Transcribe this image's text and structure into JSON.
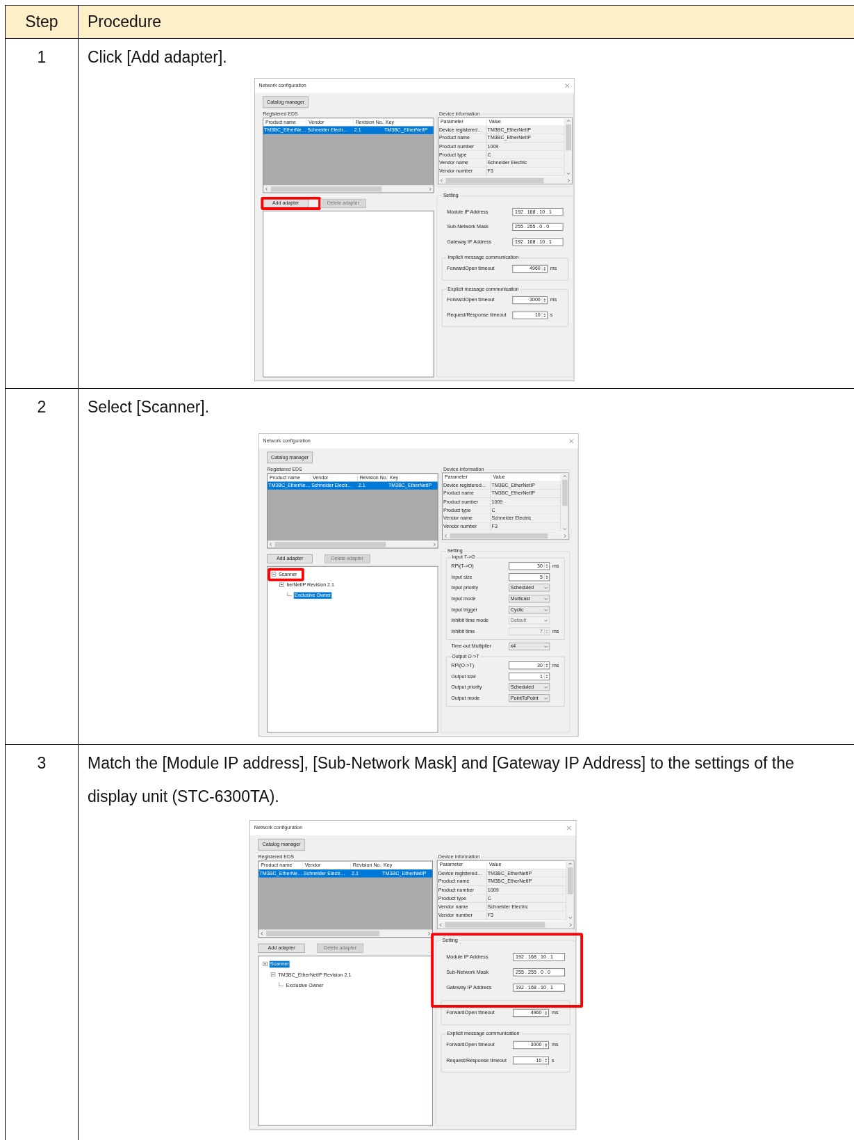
{
  "table": {
    "columns": [
      "Step",
      "Procedure"
    ],
    "rows": [
      {
        "step": "1",
        "instruction": "Click [Add adapter].",
        "dialog": {
          "title": "Network configuration",
          "catalog_button": "Catalog manager",
          "eds": {
            "label": "Registered EDS",
            "columns": [
              "Product name",
              "Vendor",
              "Revision No.",
              "Key"
            ],
            "rows": [
              {
                "cells": [
                  "TM3BC_EtherNe…",
                  "Schneider Electr…",
                  "2.1",
                  "TM3BC_EtherNetIP"
                ],
                "selected": true
              }
            ]
          },
          "device_info": {
            "label": "Device information",
            "columns": [
              "Parameter",
              "Value"
            ],
            "rows": [
              [
                "Device registered…",
                "TM3BC_EtherNetIP"
              ],
              [
                "Product name",
                "TM3BC_EtherNetIP"
              ],
              [
                "Product number",
                "1009"
              ],
              [
                "Product type",
                "C"
              ],
              [
                "Vendor name",
                "Schneider Electric"
              ],
              [
                "Vendor number",
                "F3"
              ]
            ]
          },
          "buttons": [
            {
              "label": "Add adapter",
              "disabled": false,
              "highlighted": true
            },
            {
              "label": "Delete adapter",
              "disabled": true,
              "highlighted": false
            }
          ],
          "settings": {
            "label": "Setting",
            "kind": "network",
            "highlighted": false,
            "groups": [
              {
                "framed": false,
                "rows": [
                  {
                    "kind": "ip",
                    "label": "Module IP Address",
                    "value": "192 . 168 . 10 . 1",
                    "disabled": false
                  },
                  {
                    "kind": "ip",
                    "label": "Sub-Network Mask",
                    "value": "255 . 255 . 0 . 0",
                    "disabled": false
                  },
                  {
                    "kind": "ip",
                    "label": "Gateway IP Address",
                    "value": "192 . 168 . 10 . 1",
                    "disabled": false
                  }
                ]
              },
              {
                "framed": true,
                "label": "Implicit message communication",
                "rows": [
                  {
                    "kind": "spin",
                    "label": "ForwardOpen timeout",
                    "value": "4960",
                    "unit": "ms",
                    "disabled": false
                  }
                ]
              },
              {
                "framed": true,
                "label": "Explicit message communication",
                "rows": [
                  {
                    "kind": "spin",
                    "label": "ForwardOpen timeout",
                    "value": "3000",
                    "unit": "ms",
                    "disabled": false
                  },
                  {
                    "kind": "spin",
                    "label": "Request/Response timeout",
                    "value": "10",
                    "unit": "s",
                    "disabled": false
                  }
                ]
              }
            ]
          }
        }
      },
      {
        "step": "2",
        "instruction": "Select [Scanner].",
        "dialog": {
          "title": "Network configuration",
          "catalog_button": "Catalog manager",
          "eds": {
            "label": "Registered EDS",
            "columns": [
              "Product name",
              "Vendor",
              "Revision No.",
              "Key"
            ],
            "rows": [
              {
                "cells": [
                  "TM3BC_EtherNe…",
                  "Schneider Electr…",
                  "2.1",
                  "TM3BC_EtherNetIP"
                ],
                "selected": true
              }
            ]
          },
          "device_info": {
            "label": "Device information",
            "columns": [
              "Parameter",
              "Value"
            ],
            "rows": [
              [
                "Device registered…",
                "TM3BC_EtherNetIP"
              ],
              [
                "Product name",
                "TM3BC_EtherNetIP"
              ],
              [
                "Product number",
                "1009"
              ],
              [
                "Product type",
                "C"
              ],
              [
                "Vendor name",
                "Schneider Electric"
              ],
              [
                "Vendor number",
                "F3"
              ]
            ]
          },
          "buttons": [
            {
              "label": "Add adapter",
              "disabled": false,
              "highlighted": false
            },
            {
              "label": "Delete adapter",
              "disabled": true,
              "highlighted": false
            }
          ],
          "tree": [
            {
              "label": "Scanner",
              "selected": false,
              "expanded": true,
              "highlighted": true,
              "children": [
                {
                  "label": "herNetIP Revision 2.1",
                  "selected": false,
                  "expanded": true,
                  "highlighted": false,
                  "children": [
                    {
                      "label": "Exclusive Owner",
                      "selected": true,
                      "highlighted": false
                    }
                  ]
                }
              ]
            }
          ],
          "settings": {
            "label": "Setting",
            "kind": "connection",
            "highlighted": false,
            "groups": [
              {
                "framed": true,
                "label": "Input T->O",
                "rows": [
                  {
                    "kind": "spin",
                    "label": "RPI(T->O)",
                    "value": "30",
                    "unit": "ms",
                    "disabled": false
                  },
                  {
                    "kind": "spin",
                    "label": "Input size",
                    "value": "5",
                    "disabled": false
                  },
                  {
                    "kind": "select",
                    "label": "Input priority",
                    "value": "Scheduled",
                    "disabled": false
                  },
                  {
                    "kind": "select",
                    "label": "Input mode",
                    "value": "Multicast",
                    "disabled": false
                  },
                  {
                    "kind": "select",
                    "label": "Input trigger",
                    "value": "Cyclic",
                    "disabled": false
                  },
                  {
                    "kind": "select",
                    "label": "Inhibit time mode",
                    "value": "Default",
                    "disabled": true
                  },
                  {
                    "kind": "spin",
                    "label": "Inhibit time",
                    "value": "7",
                    "unit": "ms",
                    "disabled": true
                  }
                ]
              },
              {
                "framed": false,
                "rows": [
                  {
                    "kind": "select",
                    "label": "Time-out Multiplier",
                    "value": "x4",
                    "disabled": false
                  }
                ]
              },
              {
                "framed": true,
                "label": "Output O->T",
                "rows": [
                  {
                    "kind": "spin",
                    "label": "RPI(O->T)",
                    "value": "30",
                    "unit": "ms",
                    "disabled": false
                  },
                  {
                    "kind": "spin",
                    "label": "Output size",
                    "value": "1",
                    "disabled": false
                  },
                  {
                    "kind": "select",
                    "label": "Output priority",
                    "value": "Scheduled",
                    "disabled": false
                  },
                  {
                    "kind": "select",
                    "label": "Output mode",
                    "value": "PointToPoint",
                    "disabled": false
                  }
                ]
              }
            ]
          }
        }
      },
      {
        "step": "3",
        "instruction": "Match the [Module IP address], [Sub-Network Mask] and [Gateway IP Address] to the settings of the display unit (STC-6300TA).",
        "dialog": {
          "title": "Network configuration",
          "catalog_button": "Catalog manager",
          "eds": {
            "label": "Registered EDS",
            "columns": [
              "Product name",
              "Vendor",
              "Revision No.",
              "Key"
            ],
            "rows": [
              {
                "cells": [
                  "TM3BC_EtherNe…",
                  "Schneider Electr…",
                  "2.1",
                  "TM3BC_EtherNetIP"
                ],
                "selected": true
              }
            ]
          },
          "device_info": {
            "label": "Device information",
            "columns": [
              "Parameter",
              "Value"
            ],
            "rows": [
              [
                "Device registered…",
                "TM3BC_EtherNetIP"
              ],
              [
                "Product name",
                "TM3BC_EtherNetIP"
              ],
              [
                "Product number",
                "1009"
              ],
              [
                "Product type",
                "C"
              ],
              [
                "Vendor name",
                "Schneider Electric"
              ],
              [
                "Vendor number",
                "F3"
              ]
            ]
          },
          "buttons": [
            {
              "label": "Add adapter",
              "disabled": false,
              "highlighted": false
            },
            {
              "label": "Delete adapter",
              "disabled": true,
              "highlighted": false
            }
          ],
          "tree": [
            {
              "label": "Scanner",
              "selected": true,
              "expanded": true,
              "highlighted": false,
              "children": [
                {
                  "label": "TM3BC_EtherNetIP Revision 2.1",
                  "selected": false,
                  "expanded": true,
                  "highlighted": false,
                  "children": [
                    {
                      "label": "Exclusive Owner",
                      "selected": false,
                      "highlighted": false
                    }
                  ]
                }
              ]
            }
          ],
          "settings": {
            "label": "Setting",
            "kind": "network",
            "highlighted": true,
            "groups": [
              {
                "framed": false,
                "rows": [
                  {
                    "kind": "ip",
                    "label": "Module IP Address",
                    "value": "192 . 168 . 10 . 1",
                    "disabled": false
                  },
                  {
                    "kind": "ip",
                    "label": "Sub-Network Mask",
                    "value": "255 . 255 . 0 . 0",
                    "disabled": false
                  },
                  {
                    "kind": "ip",
                    "label": "Gateway IP Address",
                    "value": "192 . 168 . 10 . 1",
                    "disabled": false
                  }
                ]
              },
              {
                "framed": true,
                "rows": [
                  {
                    "kind": "spin",
                    "label": "ForwardOpen timeout",
                    "value": "4960",
                    "unit": "ms",
                    "disabled": false
                  }
                ]
              },
              {
                "framed": true,
                "label": "Explicit message communication",
                "rows": [
                  {
                    "kind": "spin",
                    "label": "ForwardOpen timeout",
                    "value": "3000",
                    "unit": "ms",
                    "disabled": false
                  },
                  {
                    "kind": "spin",
                    "label": "Request/Response timeout",
                    "value": "10",
                    "unit": "s",
                    "disabled": false
                  }
                ]
              }
            ]
          }
        }
      }
    ]
  }
}
